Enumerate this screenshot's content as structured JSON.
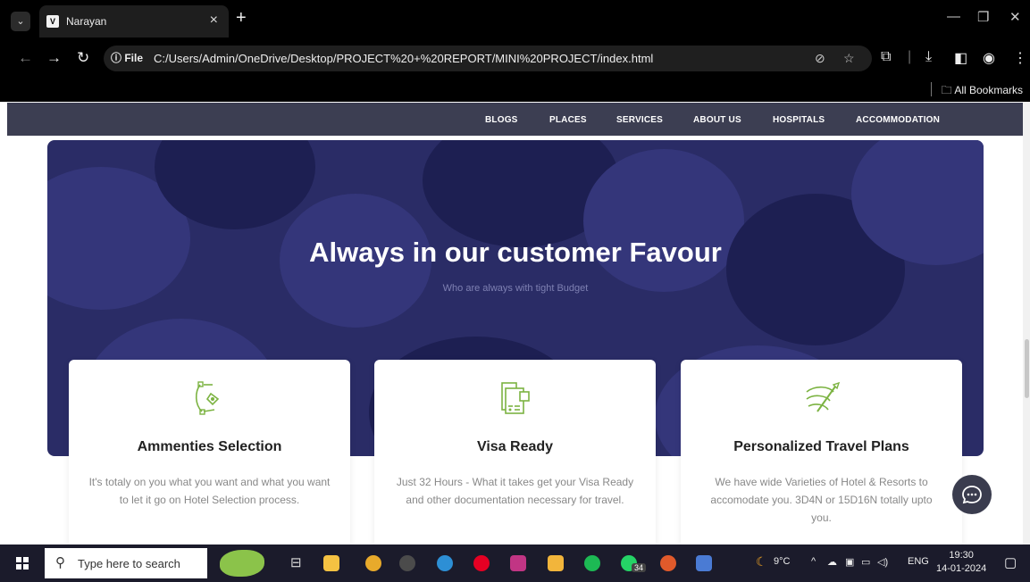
{
  "browser": {
    "tab_title": "Narayan",
    "tab_favicon": "V",
    "new_tab": "+",
    "file_label": "ⓘ File",
    "url": "C:/Users/Admin/OneDrive/Desktop/PROJECT%20+%20REPORT/MINI%20PROJECT/index.html",
    "bookmarks_label": "All Bookmarks"
  },
  "site_nav": {
    "items": [
      "BLOGS",
      "PLACES",
      "SERVICES",
      "ABOUT US",
      "HOSPITALS",
      "ACCOMMODATION"
    ]
  },
  "hero": {
    "title": "Always in our customer Favour",
    "subtitle": "Who are always with tight Budget"
  },
  "cards": [
    {
      "icon": "pen-tool-icon",
      "title": "Ammenties Selection",
      "desc": "It's totaly on you what you want and what you want to let it go on Hotel Selection process."
    },
    {
      "icon": "documents-icon",
      "title": "Visa Ready",
      "desc": "Just 32 Hours - What it takes get your Visa Ready and other documentation necessary for travel."
    },
    {
      "icon": "travel-brush-icon",
      "title": "Personalized Travel Plans",
      "desc": "We have wide Varieties of Hotel & Resorts to accomodate you. 3D4N or 15D16N totally upto you."
    }
  ],
  "taskbar": {
    "search_placeholder": "Type here to search",
    "whatsapp_badge": "34",
    "weather": "9°C",
    "language": "ENG",
    "time": "19:30",
    "date": "14-01-2024"
  },
  "colors": {
    "accent": "#7cb342",
    "nav_bg": "#3c3e52",
    "hero_bg": "#2a2c66"
  }
}
